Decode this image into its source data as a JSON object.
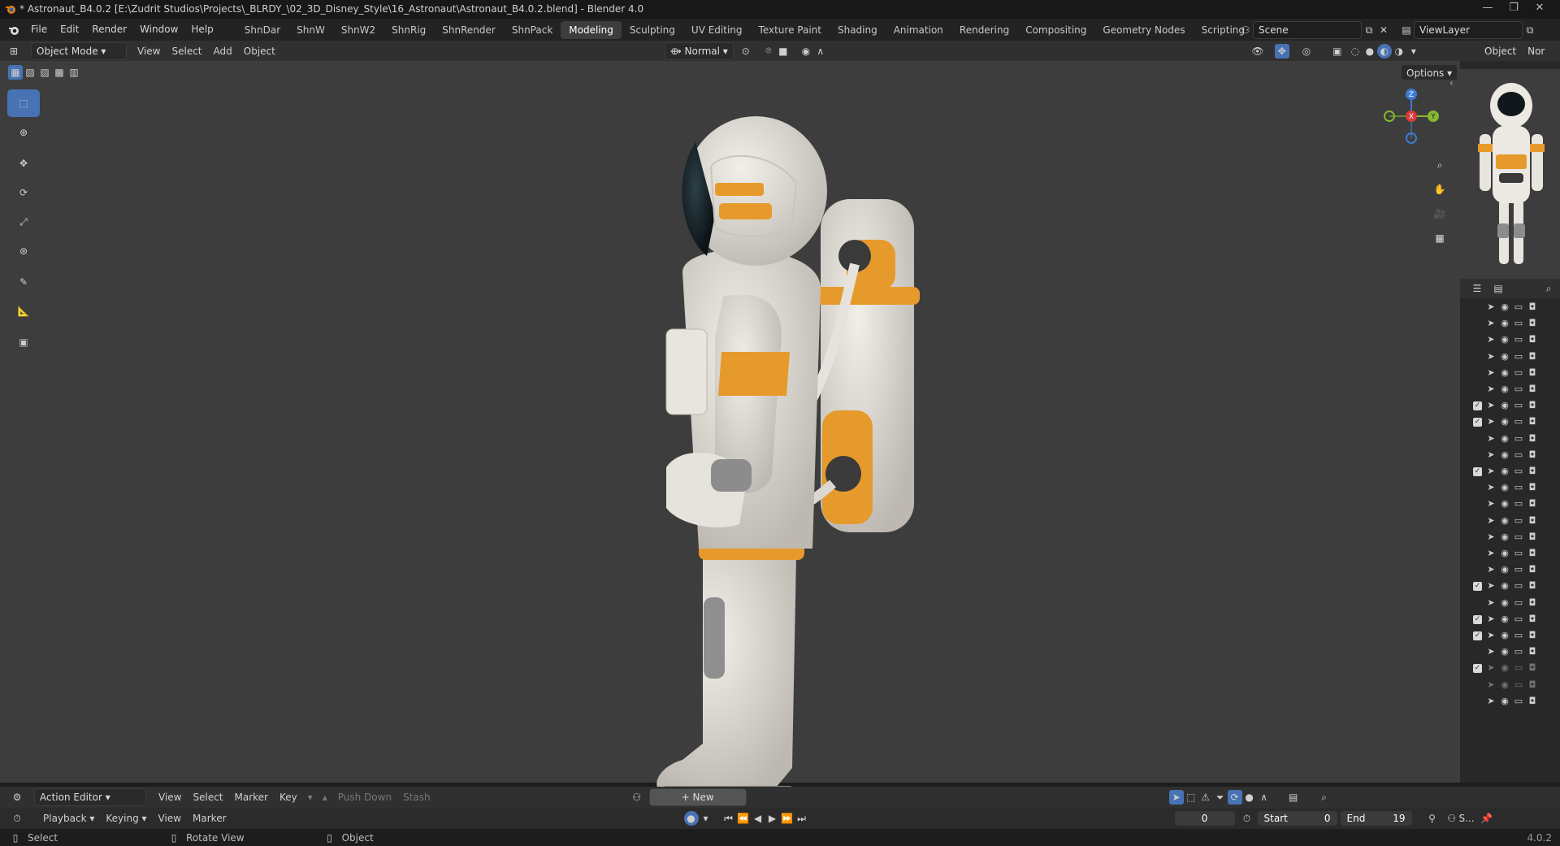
{
  "title_bar": {
    "title": "* Astronaut_B4.0.2 [E:\\Zudrit Studios\\Projects\\_BLRDY_\\02_3D_Disney_Style\\16_Astronaut\\Astronaut_B4.0.2.blend] - Blender 4.0"
  },
  "menu": {
    "items": [
      "File",
      "Edit",
      "Render",
      "Window",
      "Help"
    ],
    "workspaces": [
      "ShnDar",
      "ShnW",
      "ShnW2",
      "ShnRig",
      "ShnRender",
      "ShnPack",
      "Modeling",
      "Sculpting",
      "UV Editing",
      "Texture Paint",
      "Shading",
      "Animation",
      "Rendering",
      "Compositing",
      "Geometry Nodes",
      "Scripting"
    ],
    "active_workspace": "Modeling",
    "scene": "Scene",
    "view_layer": "ViewLayer"
  },
  "viewport_header": {
    "mode": "Object Mode",
    "menus": [
      "View",
      "Select",
      "Add",
      "Object"
    ],
    "orientation": "Normal",
    "options": "Options"
  },
  "gizmo": {
    "x": "X",
    "y": "Y",
    "z": "Z"
  },
  "properties": {
    "tab_label": "Object",
    "tab2_label": "Nor"
  },
  "outliner": {
    "rows": [
      {
        "checked": false,
        "dim": false
      },
      {
        "checked": false,
        "dim": false
      },
      {
        "checked": false,
        "dim": false
      },
      {
        "checked": false,
        "dim": false
      },
      {
        "checked": false,
        "dim": false
      },
      {
        "checked": false,
        "dim": false
      },
      {
        "checked": true,
        "dim": false
      },
      {
        "checked": true,
        "dim": false
      },
      {
        "checked": false,
        "dim": false
      },
      {
        "checked": false,
        "dim": false
      },
      {
        "checked": true,
        "dim": false
      },
      {
        "checked": false,
        "dim": false
      },
      {
        "checked": false,
        "dim": false
      },
      {
        "checked": false,
        "dim": false
      },
      {
        "checked": false,
        "dim": false
      },
      {
        "checked": false,
        "dim": false
      },
      {
        "checked": false,
        "dim": false
      },
      {
        "checked": true,
        "dim": false
      },
      {
        "checked": false,
        "dim": false
      },
      {
        "checked": true,
        "dim": false
      },
      {
        "checked": true,
        "dim": false
      },
      {
        "checked": false,
        "dim": false
      },
      {
        "checked": true,
        "dim": true
      },
      {
        "checked": false,
        "dim": true
      },
      {
        "checked": false,
        "dim": false
      }
    ]
  },
  "action_editor": {
    "editor": "Action Editor",
    "menus": [
      "View",
      "Select",
      "Marker",
      "Key"
    ],
    "push_down": "Push Down",
    "stash": "Stash",
    "new": "New"
  },
  "timeline": {
    "menus": [
      "Playback",
      "Keying",
      "View",
      "Marker"
    ],
    "frame": "0",
    "start_label": "Start",
    "start": "0",
    "end_label": "End",
    "end": "19",
    "scene_short": "S..."
  },
  "status": {
    "select": "Select",
    "rotate": "Rotate View",
    "object": "Object",
    "version": "4.0.2"
  }
}
